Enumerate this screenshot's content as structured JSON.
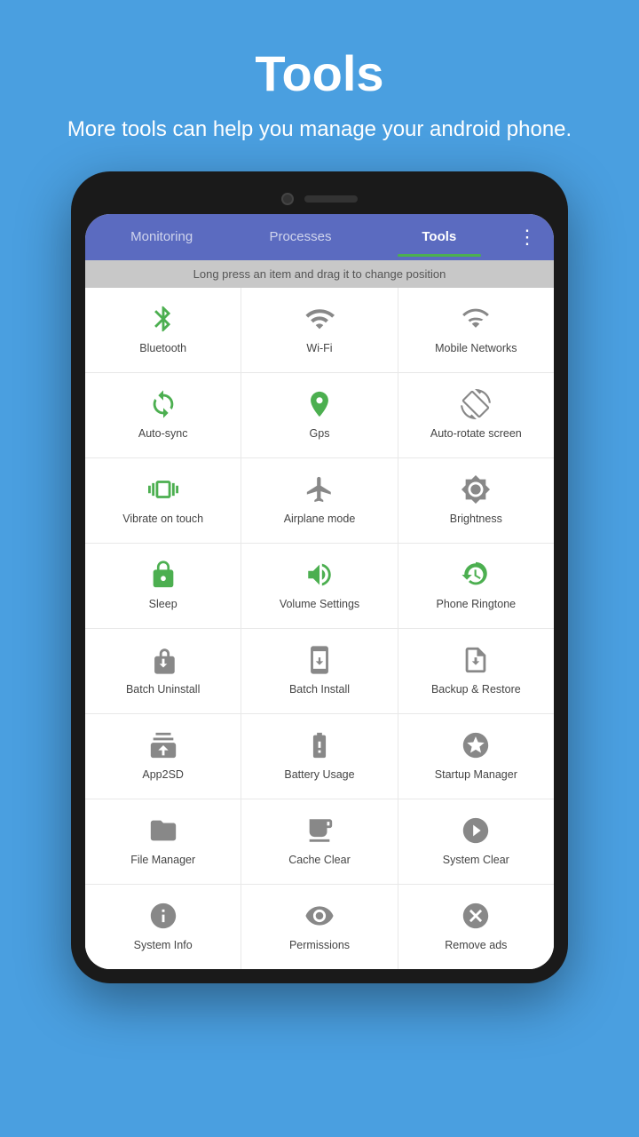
{
  "header": {
    "title": "Tools",
    "subtitle": "More tools can help you manage your android phone."
  },
  "tabs": [
    {
      "label": "Monitoring",
      "active": false
    },
    {
      "label": "Processes",
      "active": false
    },
    {
      "label": "Tools",
      "active": true
    }
  ],
  "more_icon": "⋮",
  "drag_hint": "Long press an item and drag it to change position",
  "tools": [
    {
      "label": "Bluetooth",
      "icon_type": "bluetooth",
      "color": "green"
    },
    {
      "label": "Wi-Fi",
      "icon_type": "wifi",
      "color": "gray"
    },
    {
      "label": "Mobile Networks",
      "icon_type": "mobile_network",
      "color": "gray"
    },
    {
      "label": "Auto-sync",
      "icon_type": "autosync",
      "color": "green"
    },
    {
      "label": "Gps",
      "icon_type": "gps",
      "color": "green"
    },
    {
      "label": "Auto-rotate screen",
      "icon_type": "autorotate",
      "color": "gray"
    },
    {
      "label": "Vibrate on touch",
      "icon_type": "vibrate",
      "color": "green"
    },
    {
      "label": "Airplane mode",
      "icon_type": "airplane",
      "color": "gray"
    },
    {
      "label": "Brightness",
      "icon_type": "brightness",
      "color": "gray"
    },
    {
      "label": "Sleep",
      "icon_type": "sleep",
      "color": "green"
    },
    {
      "label": "Volume Settings",
      "icon_type": "volume",
      "color": "green"
    },
    {
      "label": "Phone Ringtone",
      "icon_type": "ringtone",
      "color": "green"
    },
    {
      "label": "Batch Uninstall",
      "icon_type": "batch_uninstall",
      "color": "gray"
    },
    {
      "label": "Batch Install",
      "icon_type": "batch_install",
      "color": "gray"
    },
    {
      "label": "Backup & Restore",
      "icon_type": "backup",
      "color": "gray"
    },
    {
      "label": "App2SD",
      "icon_type": "app2sd",
      "color": "gray"
    },
    {
      "label": "Battery Usage",
      "icon_type": "battery",
      "color": "gray"
    },
    {
      "label": "Startup Manager",
      "icon_type": "startup",
      "color": "gray"
    },
    {
      "label": "File Manager",
      "icon_type": "file",
      "color": "gray"
    },
    {
      "label": "Cache Clear",
      "icon_type": "cache",
      "color": "gray"
    },
    {
      "label": "System Clear",
      "icon_type": "system_clear",
      "color": "gray"
    },
    {
      "label": "System Info",
      "icon_type": "system_info",
      "color": "gray"
    },
    {
      "label": "Permissions",
      "icon_type": "permissions",
      "color": "gray"
    },
    {
      "label": "Remove ads",
      "icon_type": "remove_ads",
      "color": "gray"
    }
  ]
}
